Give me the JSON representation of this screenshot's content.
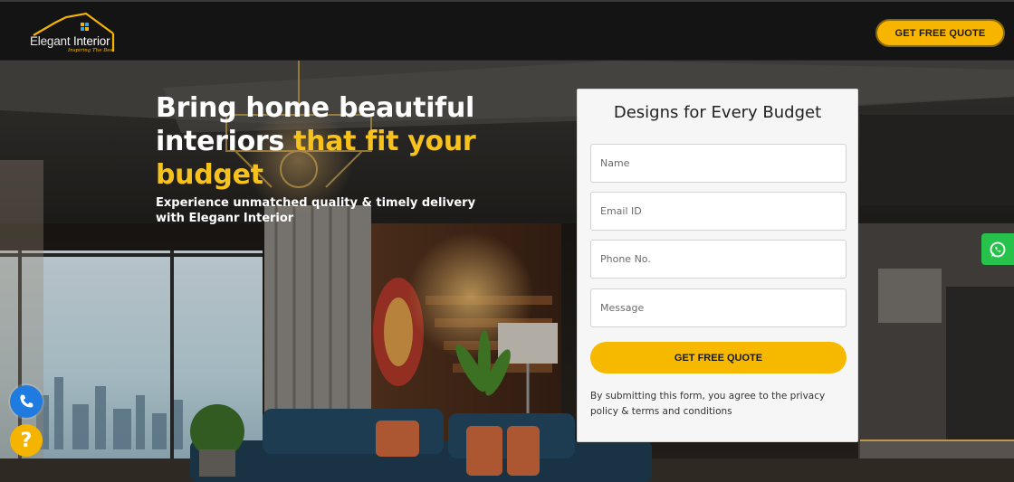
{
  "header": {
    "logo": {
      "name_part1": "Elegant",
      "name_part2": "Interior",
      "tagline": "Inspiring The Best",
      "icon": "house-roof-icon"
    },
    "cta_label": "GET FREE QUOTE"
  },
  "hero": {
    "headline_white": "Bring home beautiful interiors ",
    "headline_accent": "that fit your budget",
    "subline": "Experience unmatched quality & timely delivery with Eleganr Interior",
    "background": "living-room-photo"
  },
  "form": {
    "title": "Designs for Every Budget",
    "name_placeholder": "Name",
    "email_placeholder": "Email ID",
    "phone_placeholder": "Phone No.",
    "message_placeholder": "Message",
    "submit_label": "GET FREE QUOTE",
    "disclaimer": "By submitting this form, you agree to the privacy policy & terms and conditions"
  },
  "widgets": {
    "whatsapp_icon": "whatsapp-icon",
    "phone_icon": "phone-icon",
    "help_label": "?"
  },
  "colors": {
    "accent": "#f7b800",
    "header_bg": "#141414",
    "whatsapp": "#27c24c",
    "phone": "#1f7be0"
  }
}
